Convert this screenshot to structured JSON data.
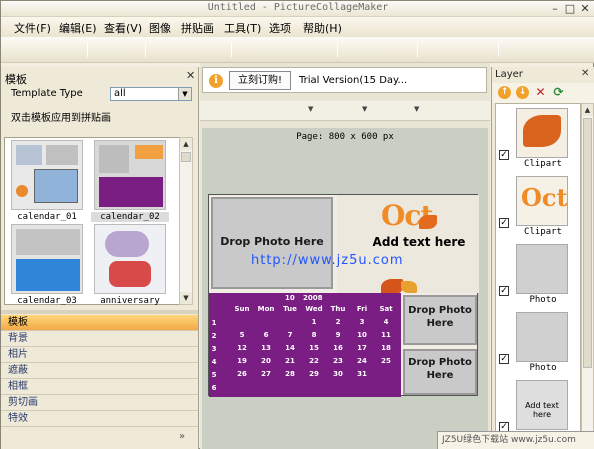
{
  "window": {
    "title": "Untitled - PictureCollageMaker",
    "min": "–",
    "max": "□",
    "close": "✕"
  },
  "menu": [
    "文件(F)",
    "编辑(E)",
    "查看(V)",
    "图像",
    "拼贴画",
    "工具(T)",
    "选项",
    "帮助(H)"
  ],
  "left_panel": {
    "title": "模板",
    "close": "✕",
    "template_type_label": "Template Type",
    "template_type_value": "all",
    "apply_hint": "双击模板应用到拼贴画",
    "templates": [
      {
        "label": "calendar_01"
      },
      {
        "label": "calendar_02"
      },
      {
        "label": "calendar_03"
      },
      {
        "label": "anniversary"
      }
    ],
    "categories": [
      "模板",
      "背景",
      "相片",
      "遮蔽",
      "相框",
      "剪切画",
      "特效"
    ],
    "active_category": "模板",
    "more": "»"
  },
  "trial": {
    "order_button": "立刻订购!",
    "text": "Trial Version(15 Day..."
  },
  "canvas": {
    "page_label": "Page: 800 x 600 px",
    "drop_photo": "Drop Photo Here",
    "add_text": "Add text here",
    "oct": "Oct",
    "watermark": "http://www.jz5u.com",
    "calendar": {
      "month": "10",
      "year": "2008",
      "weekdays": [
        "Sun",
        "Mon",
        "Tue",
        "Wed",
        "Thu",
        "Fri",
        "Sat"
      ],
      "weeks": [
        [
          "",
          "",
          "",
          "1",
          "2",
          "3",
          "4"
        ],
        [
          "5",
          "6",
          "7",
          "8",
          "9",
          "10",
          "11"
        ],
        [
          "12",
          "13",
          "14",
          "15",
          "16",
          "17",
          "18"
        ],
        [
          "19",
          "20",
          "21",
          "22",
          "23",
          "24",
          "25"
        ],
        [
          "26",
          "27",
          "28",
          "29",
          "30",
          "31",
          ""
        ]
      ],
      "left_col": [
        "1",
        "2",
        "3",
        "4",
        "5",
        "6"
      ]
    }
  },
  "layer_panel": {
    "title": "Layer",
    "close": "✕",
    "layers": [
      {
        "label": "Clipart",
        "checked": true
      },
      {
        "label": "Clipart",
        "checked": true
      },
      {
        "label": "Photo",
        "checked": true
      },
      {
        "label": "Photo",
        "checked": true
      },
      {
        "label": "Add text here",
        "checked": true
      }
    ]
  },
  "corner_banner": "JZ5U绿色下载站 www.jz5u.com",
  "colors": {
    "accent": "#f3a948",
    "calendar": "#7a1e84",
    "link": "#2255ff"
  }
}
